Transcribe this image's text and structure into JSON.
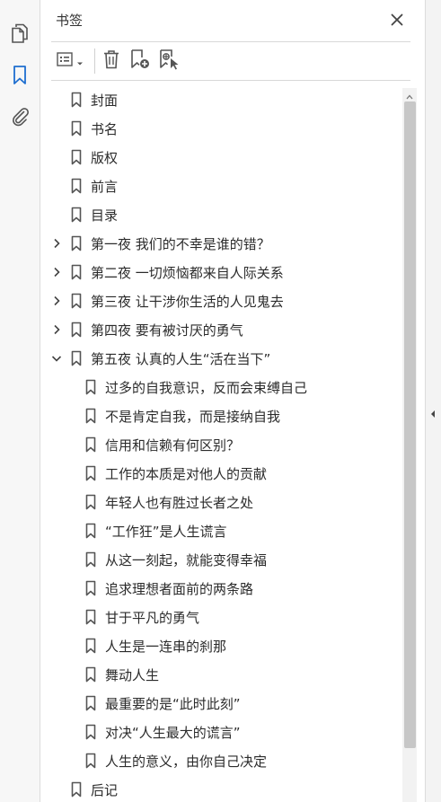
{
  "panel": {
    "title": "书签"
  },
  "toolbar": {
    "options": "options-menu",
    "delete": "delete-bookmark",
    "new": "new-bookmark",
    "new_from_structure": "new-bookmark-from-structure"
  },
  "bookmarks": [
    {
      "label": "封面",
      "level": 0,
      "expander": "none"
    },
    {
      "label": "书名",
      "level": 0,
      "expander": "none"
    },
    {
      "label": "版权",
      "level": 0,
      "expander": "none"
    },
    {
      "label": "前言",
      "level": 0,
      "expander": "none"
    },
    {
      "label": "目录",
      "level": 0,
      "expander": "none"
    },
    {
      "label": "第一夜  我们的不幸是谁的错？",
      "level": 0,
      "expander": "collapsed"
    },
    {
      "label": "第二夜  一切烦恼都来自人际关系",
      "level": 0,
      "expander": "collapsed"
    },
    {
      "label": "第三夜  让干涉你生活的人见鬼去",
      "level": 0,
      "expander": "collapsed"
    },
    {
      "label": "第四夜  要有被讨厌的勇气",
      "level": 0,
      "expander": "collapsed"
    },
    {
      "label": "第五夜  认真的人生“活在当下”",
      "level": 0,
      "expander": "expanded"
    },
    {
      "label": "过多的自我意识，反而会束缚自己",
      "level": 1,
      "expander": "none"
    },
    {
      "label": "不是肯定自我，而是接纳自我",
      "level": 1,
      "expander": "none"
    },
    {
      "label": "信用和信赖有何区别？",
      "level": 1,
      "expander": "none"
    },
    {
      "label": "工作的本质是对他人的贡献",
      "level": 1,
      "expander": "none"
    },
    {
      "label": "年轻人也有胜过长者之处",
      "level": 1,
      "expander": "none"
    },
    {
      "label": "“工作狂”是人生谎言",
      "level": 1,
      "expander": "none"
    },
    {
      "label": "从这一刻起，就能变得幸福",
      "level": 1,
      "expander": "none"
    },
    {
      "label": "追求理想者面前的两条路",
      "level": 1,
      "expander": "none"
    },
    {
      "label": "甘于平凡的勇气",
      "level": 1,
      "expander": "none"
    },
    {
      "label": "人生是一连串的刹那",
      "level": 1,
      "expander": "none"
    },
    {
      "label": "舞动人生",
      "level": 1,
      "expander": "none"
    },
    {
      "label": "最重要的是“此时此刻”",
      "level": 1,
      "expander": "none"
    },
    {
      "label": "对决“人生最大的谎言”",
      "level": 1,
      "expander": "none"
    },
    {
      "label": "人生的意义，由你自己决定",
      "level": 1,
      "expander": "none"
    },
    {
      "label": "后记",
      "level": 0,
      "expander": "none"
    }
  ],
  "colors": {
    "accent": "#1f6fd0",
    "icon": "#555555",
    "scroll_thumb": "#c7c7c7"
  },
  "icons": {
    "rail": [
      "pages-icon",
      "bookmark-icon",
      "attachment-icon"
    ],
    "close": "close-icon",
    "collapse": "collapse-left-icon"
  }
}
